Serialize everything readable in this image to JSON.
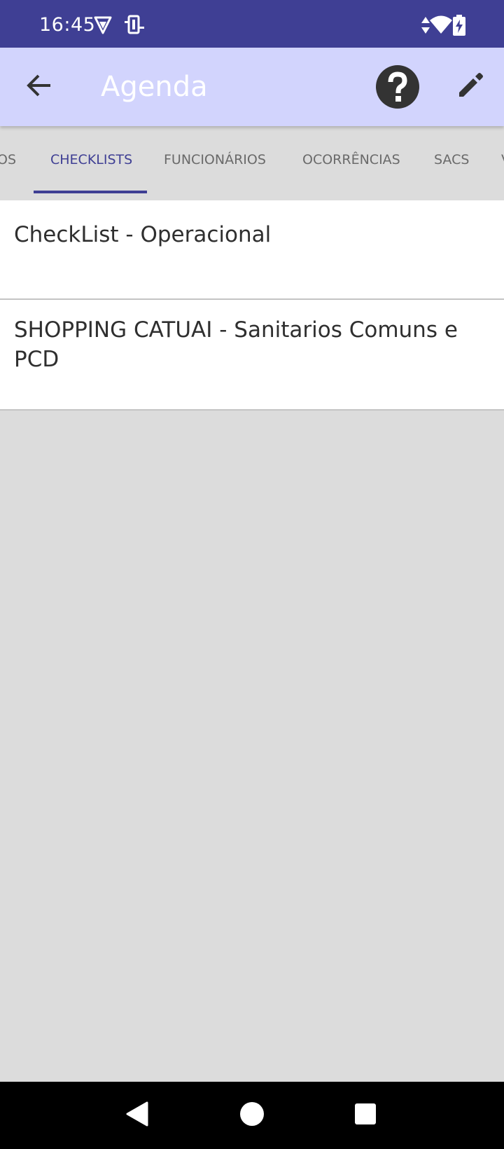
{
  "status_bar": {
    "time": "16:45",
    "background": "#3f3f94",
    "icons": [
      "vpn-shield-icon",
      "device-icon",
      "data-arrows-icon",
      "wifi-icon",
      "battery-charging-icon"
    ]
  },
  "app_bar": {
    "title": "Agenda",
    "background": "#d2d4fd",
    "back_icon": "arrow-left-icon",
    "help_icon": "help-circle-icon",
    "edit_icon": "pencil-icon"
  },
  "tabs": {
    "items": [
      {
        "label": "OS"
      },
      {
        "label": "CHECKLISTS",
        "active": true
      },
      {
        "label": "FUNCIONÁRIOS"
      },
      {
        "label": "OCORRÊNCIAS"
      },
      {
        "label": "SACS"
      },
      {
        "label": "V"
      }
    ],
    "accent": "#3f3f94"
  },
  "list": {
    "items": [
      {
        "title": "CheckList - Operacional"
      },
      {
        "title": "SHOPPING CATUAI - Sanitarios Comuns e PCD"
      }
    ]
  },
  "nav_bar": {
    "icons": [
      "back-triangle-icon",
      "home-circle-icon",
      "recents-square-icon"
    ]
  }
}
